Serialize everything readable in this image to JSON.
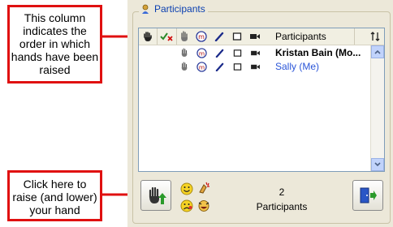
{
  "callouts": {
    "hand_order": "This column indicates the order in which hands have been raised",
    "raise_hand": "Click here to raise (and lower) your hand"
  },
  "panel": {
    "title": "Participants",
    "list": {
      "header_label": "Participants",
      "sort_icon": "sort-icon",
      "rows": [
        {
          "name": "Kristan Bain (Mo...",
          "style": "bold"
        },
        {
          "name": "Sally (Me)",
          "style": "me"
        }
      ]
    },
    "footer": {
      "count": "2",
      "count_label": "Participants"
    }
  },
  "colors": {
    "callout_border": "#e01010",
    "panel_bg": "#ece8d9",
    "title_blue": "#0a3fb0",
    "me_blue": "#2a55d8",
    "arrow_red": "#e01010"
  }
}
